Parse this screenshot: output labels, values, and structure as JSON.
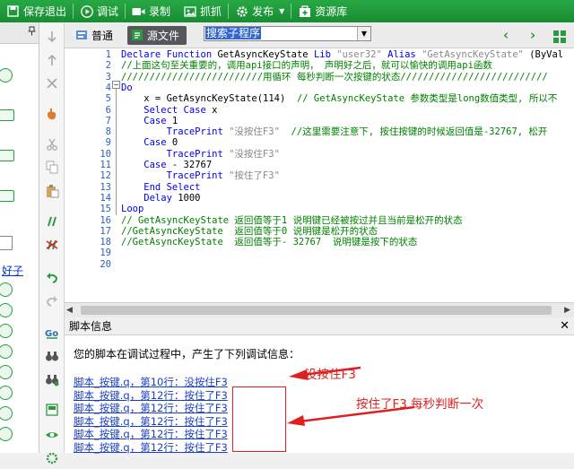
{
  "toolbar": {
    "items": [
      {
        "label": "保存退出",
        "icon": "save-exit-icon"
      },
      {
        "label": "调试",
        "icon": "debug-play-icon"
      },
      {
        "label": "录制",
        "icon": "record-camera-icon"
      },
      {
        "label": "抓抓",
        "icon": "capture-icon"
      },
      {
        "label": "发布",
        "icon": "publish-gear-icon"
      },
      {
        "label": "资源库",
        "icon": "resource-library-icon"
      }
    ]
  },
  "left_panel": {
    "pin": "ᵖ",
    "link_text": "好子"
  },
  "editor": {
    "tabs": [
      {
        "label": "普通"
      },
      {
        "label": "源文件"
      }
    ],
    "search_dropdown": "搜索子程序",
    "line_numbers": [
      "1",
      "2",
      "3",
      "4",
      "5",
      "6",
      "7",
      "8",
      "9",
      "10",
      "11",
      "12",
      "13",
      "14",
      "15",
      "16",
      "17",
      "18",
      "19",
      "20"
    ]
  },
  "code": [
    {
      "parts": [
        [
          "kw",
          "Declare Function "
        ],
        [
          "",
          "GetAsyncKeyState "
        ],
        [
          "kw",
          "Lib "
        ],
        [
          "str",
          "\"user32\" "
        ],
        [
          "kw",
          "Alias "
        ],
        [
          "str",
          "\"GetAsyncKeyState\" "
        ],
        [
          "",
          "(ByVal"
        ]
      ]
    },
    {
      "parts": [
        [
          "cm",
          "//上面这句至关重要的，调用api接口的声明， 声明好之后，就可以愉快的调用api函数"
        ]
      ]
    },
    {
      "parts": [
        [
          "cm",
          "/////////////////////////用循环 每秒判断一次按键的状态//////////////////////////"
        ]
      ]
    },
    {
      "parts": [
        [
          "kw",
          "Do"
        ]
      ]
    },
    {
      "parts": [
        [
          "",
          "    x = GetAsyncKeyState(114)  "
        ],
        [
          "cm",
          "// GetAsyncKeyState 参数类型是long数值类型, 所以不"
        ]
      ]
    },
    {
      "parts": [
        [
          "kw",
          "    Select Case "
        ],
        [
          "",
          "x"
        ]
      ]
    },
    {
      "parts": [
        [
          "kw",
          "    Case "
        ],
        [
          "",
          "1"
        ]
      ]
    },
    {
      "parts": [
        [
          "kw",
          "        TracePrint "
        ],
        [
          "str",
          "\"没按住F3\"  "
        ],
        [
          "cm",
          "//这里需要注意下, 按住按键的时候返回值是-32767, 松开"
        ]
      ]
    },
    {
      "parts": [
        [
          "kw",
          "    Case "
        ],
        [
          "",
          "0"
        ]
      ]
    },
    {
      "parts": [
        [
          "kw",
          "        TracePrint "
        ],
        [
          "str",
          "\"没按住F3\""
        ]
      ]
    },
    {
      "parts": [
        [
          "kw",
          "    Case "
        ],
        [
          "",
          "- 32767"
        ]
      ]
    },
    {
      "parts": [
        [
          "kw",
          "        TracePrint "
        ],
        [
          "str",
          "\"按住了F3\""
        ]
      ]
    },
    {
      "parts": [
        [
          "kw",
          "    End Select"
        ]
      ]
    },
    {
      "parts": [
        [
          "kw",
          "    Delay "
        ],
        [
          "",
          "1000"
        ]
      ]
    },
    {
      "parts": [
        [
          "kw",
          "Loop"
        ]
      ]
    },
    {
      "parts": [
        [
          "cm",
          "// GetAsyncKeyState 返回值等于1 说明键已经被按过并且当前是松开的状态"
        ]
      ]
    },
    {
      "parts": [
        [
          "cm",
          "//GetAsyncKeyState  返回值等于0 说明键是松开的状态"
        ]
      ]
    },
    {
      "parts": [
        [
          "cm",
          "//GetAsyncKeyState  返回值等于- 32767  说明键是按下的状态"
        ]
      ]
    },
    {
      "parts": [
        [
          "",
          ""
        ]
      ]
    },
    {
      "parts": [
        [
          "",
          ""
        ]
      ]
    }
  ],
  "info_panel": {
    "title": "脚本信息",
    "close": "✕",
    "message": "您的脚本在调试过程中，产生了下列调试信息：",
    "log_lines": [
      "脚本_按键.q，第10行：没按住F3",
      "脚本_按键.q，第12行：按住了F3",
      "脚本_按键.q，第12行：按住了F3",
      "脚本_按键.q，第12行：按住了F3",
      "脚本_按键.q，第12行：按住了F3",
      "脚本_按键.q，第12行：按住了F3"
    ],
    "annotation_1": "没按住F3",
    "annotation_2": "按住了F3 每秒判断一次",
    "annotation_color": "#e02020"
  }
}
